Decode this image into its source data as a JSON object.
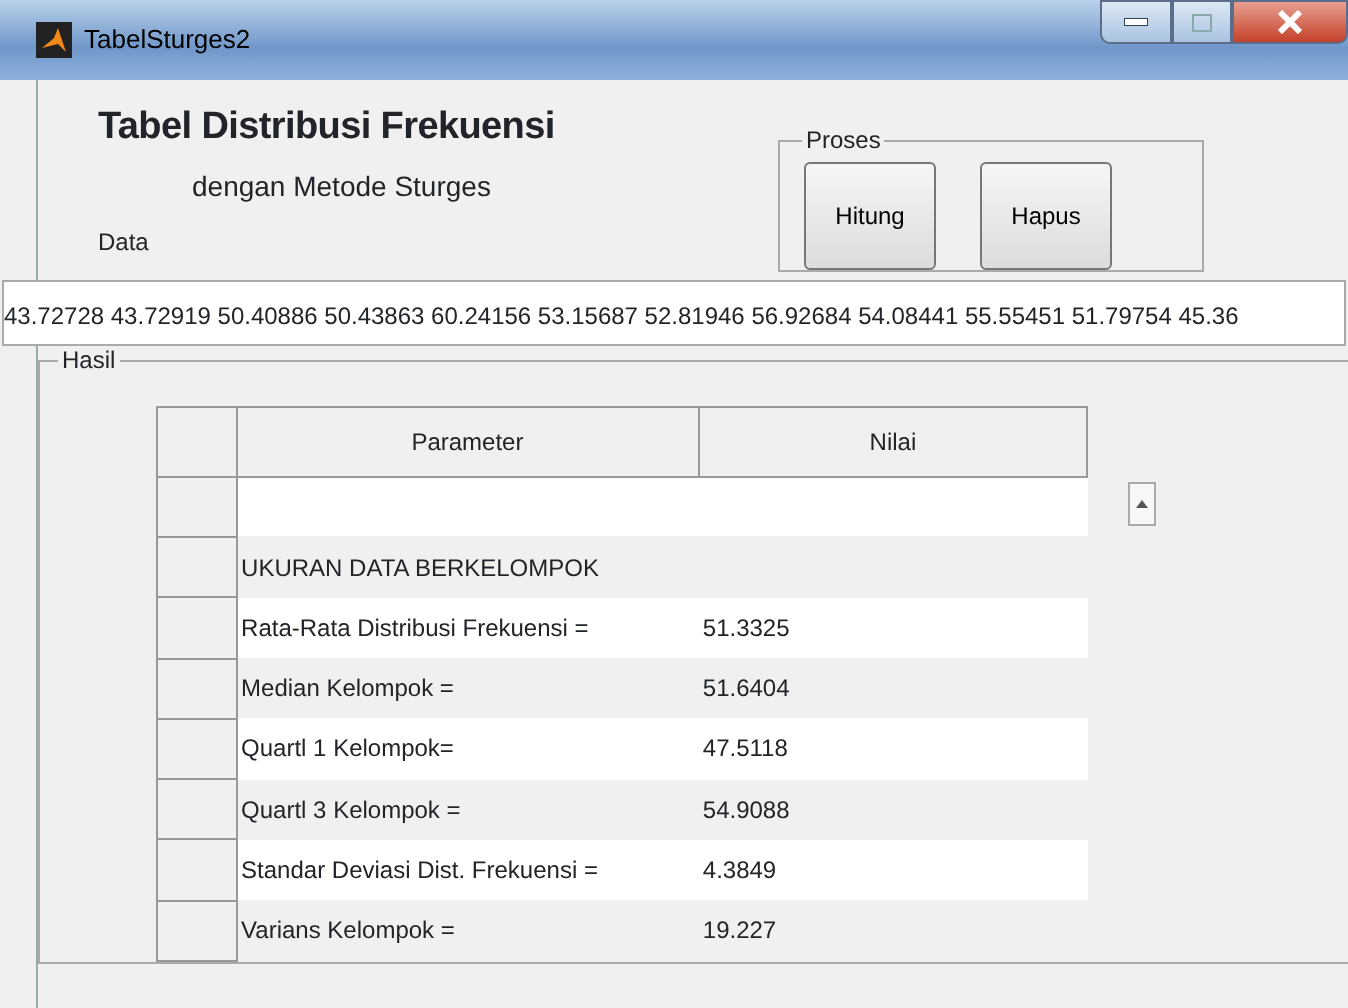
{
  "window": {
    "title": "TabelSturges2"
  },
  "header": {
    "title": "Tabel Distribusi Frekuensi",
    "subtitle": "dengan Metode Sturges"
  },
  "proses": {
    "label": "Proses",
    "buttons": [
      "Hitung",
      "Hapus"
    ]
  },
  "data": {
    "label": "Data",
    "value": "43.72728 43.72919 50.40886 50.43863 60.24156 53.15687 52.81946 56.92684 54.08441 55.55451 51.79754 45.36"
  },
  "hasil": {
    "label": "Hasil",
    "table": {
      "columns": [
        "Parameter",
        "Nilai"
      ],
      "rows": [
        [
          "",
          ""
        ],
        [
          "UKURAN DATA BERKELOMPOK",
          ""
        ],
        [
          "Rata-Rata Distribusi Frekuensi =",
          "51.3325"
        ],
        [
          "Median Kelompok =",
          "51.6404"
        ],
        [
          "Quartl 1 Kelompok=",
          "47.5118"
        ],
        [
          "Quartl 3 Kelompok =",
          "54.9088"
        ],
        [
          "Standar Deviasi Dist. Frekuensi =",
          "4.3849"
        ],
        [
          "Varians Kelompok =",
          "19.227"
        ]
      ]
    }
  }
}
